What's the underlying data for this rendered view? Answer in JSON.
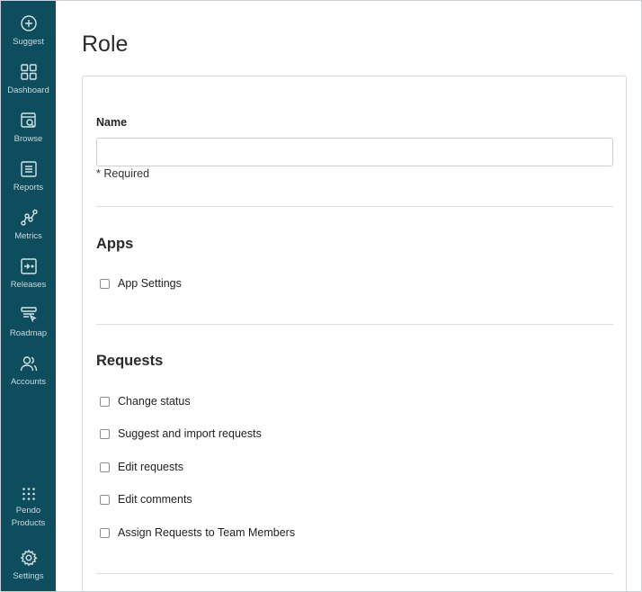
{
  "sidebar": {
    "items": [
      {
        "label": "Suggest",
        "icon": "plus-circle-icon"
      },
      {
        "label": "Dashboard",
        "icon": "grid-icon"
      },
      {
        "label": "Browse",
        "icon": "browse-icon"
      },
      {
        "label": "Reports",
        "icon": "list-icon"
      },
      {
        "label": "Metrics",
        "icon": "metrics-icon"
      },
      {
        "label": "Releases",
        "icon": "releases-icon"
      },
      {
        "label": "Roadmap",
        "icon": "roadmap-icon"
      },
      {
        "label": "Accounts",
        "icon": "accounts-icon"
      }
    ],
    "bottom_items": [
      {
        "label_line1": "Pendo",
        "label_line2": "Products",
        "icon": "dots-grid-icon"
      },
      {
        "label": "Settings",
        "icon": "gear-icon"
      }
    ],
    "color": "#0e4d5e"
  },
  "page": {
    "title": "Role"
  },
  "form": {
    "name_label": "Name",
    "name_value": "",
    "name_placeholder": "",
    "required_text": "* Required",
    "sections": [
      {
        "title": "Apps",
        "options": [
          {
            "label": "App Settings",
            "checked": false
          }
        ]
      },
      {
        "title": "Requests",
        "options": [
          {
            "label": "Change status",
            "checked": false
          },
          {
            "label": "Suggest and import requests",
            "checked": false
          },
          {
            "label": "Edit requests",
            "checked": false
          },
          {
            "label": "Edit comments",
            "checked": false
          },
          {
            "label": "Assign Requests to Team Members",
            "checked": false
          }
        ]
      }
    ]
  }
}
